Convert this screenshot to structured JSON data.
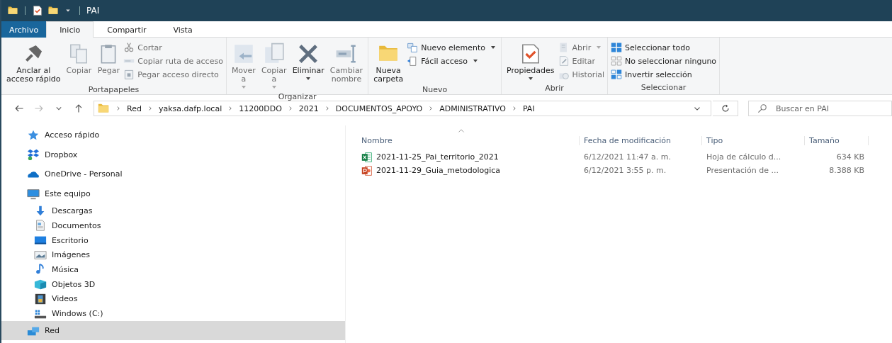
{
  "window": {
    "title": "PAI"
  },
  "ribbon_tabs": [
    {
      "label": "Archivo",
      "kind": "file",
      "selected": false
    },
    {
      "label": "Inicio",
      "kind": "tab",
      "selected": true
    },
    {
      "label": "Compartir",
      "kind": "tab",
      "selected": false
    },
    {
      "label": "Vista",
      "kind": "tab",
      "selected": false
    }
  ],
  "ribbon_groups": [
    {
      "label": "Portapapeles",
      "items": [
        {
          "label": "Anclar al\nacceso rápido",
          "kind": "large",
          "disabled": false,
          "dropdown": false
        },
        {
          "label": "Copiar",
          "kind": "large",
          "disabled": true,
          "dropdown": false
        },
        {
          "label": "Pegar",
          "kind": "large",
          "disabled": true,
          "dropdown": false
        },
        {
          "label": "Cortar",
          "kind": "small",
          "disabled": true,
          "dropdown": false
        },
        {
          "label": "Copiar ruta de acceso",
          "kind": "small",
          "disabled": true,
          "dropdown": false
        },
        {
          "label": "Pegar acceso directo",
          "kind": "small",
          "disabled": true,
          "dropdown": false
        }
      ]
    },
    {
      "label": "Organizar",
      "items": [
        {
          "label": "Mover\na",
          "kind": "large",
          "disabled": true,
          "dropdown": true
        },
        {
          "label": "Copiar\na",
          "kind": "large",
          "disabled": true,
          "dropdown": true
        },
        {
          "label": "Eliminar",
          "kind": "large",
          "disabled": false,
          "dropdown": true
        },
        {
          "label": "Cambiar\nnombre",
          "kind": "large",
          "disabled": true,
          "dropdown": false
        }
      ]
    },
    {
      "label": "Nuevo",
      "items": [
        {
          "label": "Nueva\ncarpeta",
          "kind": "large",
          "disabled": false,
          "dropdown": false
        },
        {
          "label": "Nuevo elemento",
          "kind": "small",
          "disabled": false,
          "dropdown": true
        },
        {
          "label": "Fácil acceso",
          "kind": "small",
          "disabled": false,
          "dropdown": true
        }
      ]
    },
    {
      "label": "Abrir",
      "items": [
        {
          "label": "Propiedades",
          "kind": "large",
          "disabled": false,
          "dropdown": true
        },
        {
          "label": "Abrir",
          "kind": "small",
          "disabled": true,
          "dropdown": true
        },
        {
          "label": "Editar",
          "kind": "small",
          "disabled": true,
          "dropdown": false
        },
        {
          "label": "Historial",
          "kind": "small",
          "disabled": true,
          "dropdown": false
        }
      ]
    },
    {
      "label": "Seleccionar",
      "items": [
        {
          "label": "Seleccionar todo",
          "kind": "small",
          "disabled": false,
          "dropdown": false
        },
        {
          "label": "No seleccionar ninguno",
          "kind": "small",
          "disabled": false,
          "dropdown": false
        },
        {
          "label": "Invertir selección",
          "kind": "small",
          "disabled": false,
          "dropdown": false
        }
      ]
    }
  ],
  "address_bar": {
    "crumbs": [
      "Red",
      "yaksa.dafp.local",
      "11200DDO",
      "2021",
      "DOCUMENTOS_APOYO",
      "ADMINISTRATIVO",
      "PAI"
    ]
  },
  "search": {
    "placeholder": "Buscar en PAI"
  },
  "navigation": [
    {
      "label": "Acceso rápido",
      "selected": false
    },
    {
      "label": "Dropbox",
      "selected": false
    },
    {
      "label": "OneDrive - Personal",
      "selected": false
    },
    {
      "label": "Este equipo",
      "selected": false,
      "children": [
        {
          "label": "Descargas",
          "selected": false
        },
        {
          "label": "Documentos",
          "selected": false
        },
        {
          "label": "Escritorio",
          "selected": false
        },
        {
          "label": "Imágenes",
          "selected": false
        },
        {
          "label": "Música",
          "selected": false
        },
        {
          "label": "Objetos 3D",
          "selected": false
        },
        {
          "label": "Videos",
          "selected": false
        },
        {
          "label": "Windows (C:)",
          "selected": false
        }
      ]
    },
    {
      "label": "Red",
      "selected": true
    }
  ],
  "file_list": {
    "columns": [
      "Nombre",
      "Fecha de modificación",
      "Tipo",
      "Tamaño"
    ],
    "rows": [
      {
        "kind": "xlsx",
        "name": "2021-11-25_Pai_territorio_2021",
        "modified": "6/12/2021 11:47 a. m.",
        "type": "Hoja de cálculo d...",
        "size": "634 KB"
      },
      {
        "kind": "pptx",
        "name": "2021-11-29_Guia_metodologica",
        "modified": "6/12/2021 3:55 p. m.",
        "type": "Presentación de ...",
        "size": "8.388 KB"
      }
    ]
  }
}
